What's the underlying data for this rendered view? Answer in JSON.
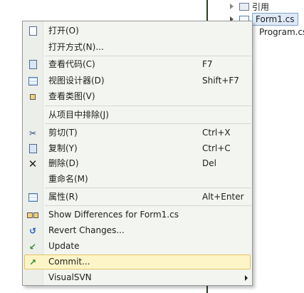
{
  "explorer": {
    "items": [
      {
        "label": "引用"
      },
      {
        "label": "Form1.cs"
      },
      {
        "label": "Program.cs"
      }
    ]
  },
  "menu": {
    "items": [
      {
        "label": "打开(O)",
        "shortcut": "",
        "icon": "open-icon"
      },
      {
        "label": "打开方式(N)...",
        "shortcut": "",
        "icon": ""
      },
      {
        "label": "查看代码(C)",
        "shortcut": "F7",
        "icon": "view-code-icon"
      },
      {
        "label": "视图设计器(D)",
        "shortcut": "Shift+F7",
        "icon": "view-designer-icon"
      },
      {
        "label": "查看类图(V)",
        "shortcut": "",
        "icon": "class-diagram-icon"
      },
      {
        "label": "从项目中排除(J)",
        "shortcut": "",
        "icon": ""
      },
      {
        "label": "剪切(T)",
        "shortcut": "Ctrl+X",
        "icon": "cut-icon"
      },
      {
        "label": "复制(Y)",
        "shortcut": "Ctrl+C",
        "icon": "copy-icon"
      },
      {
        "label": "删除(D)",
        "shortcut": "Del",
        "icon": "delete-icon"
      },
      {
        "label": "重命名(M)",
        "shortcut": "",
        "icon": ""
      },
      {
        "label": "属性(R)",
        "shortcut": "Alt+Enter",
        "icon": "properties-icon"
      },
      {
        "label": "Show Differences for Form1.cs",
        "shortcut": "",
        "icon": "show-differences-icon"
      },
      {
        "label": "Revert Changes...",
        "shortcut": "",
        "icon": "revert-icon"
      },
      {
        "label": "Update",
        "shortcut": "",
        "icon": "update-icon"
      },
      {
        "label": "Commit...",
        "shortcut": "",
        "icon": "commit-icon"
      },
      {
        "label": "VisualSVN",
        "shortcut": "",
        "icon": ""
      }
    ]
  },
  "colors": {
    "menu_bg": "#f3f5f0",
    "highlight_bg": "#fdf5c8",
    "highlight_border": "#e5c365"
  }
}
